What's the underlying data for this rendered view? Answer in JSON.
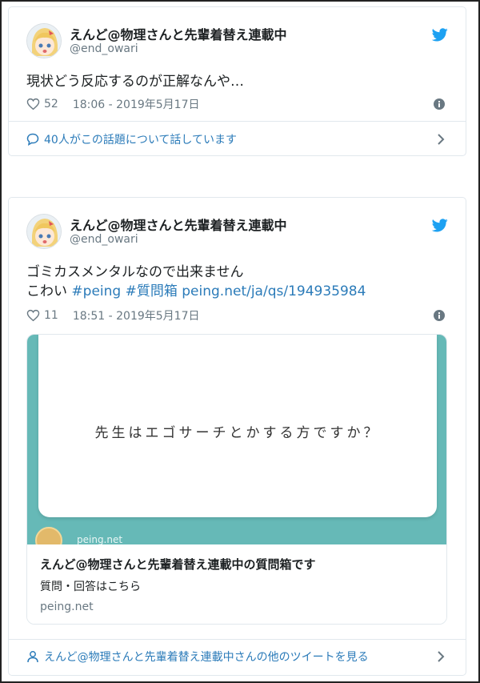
{
  "colors": {
    "twitter_blue": "#1da1f2",
    "link_blue": "#2b7bb9",
    "muted_gray": "#697882",
    "border": "#e1e8ed",
    "card_teal": "#66b9b7"
  },
  "tweets": [
    {
      "author_name": "えんど@物理さんと先輩着替え連載中",
      "author_handle": "@end_owari",
      "text_line1": "現状どう反応するのが正解なんや…",
      "likes": "52",
      "timestamp": "18:06 - 2019年5月17日",
      "footer_link": "40人がこの話題について話しています",
      "icons": {
        "like": "heart-icon",
        "info": "info-icon",
        "reply": "speech-bubble-icon",
        "more": "chevron-right-icon",
        "brand": "twitter-bird-icon"
      }
    },
    {
      "author_name": "えんど@物理さんと先輩着替え連載中",
      "author_handle": "@end_owari",
      "text_line1": "ゴミカスメンタルなので出来ません",
      "text_line2_plain": "こわい",
      "hashtag1": "#peing",
      "hashtag2": "#質問箱",
      "url": "peing.net/ja/qs/194935984",
      "likes": "11",
      "timestamp": "18:51 - 2019年5月17日",
      "card": {
        "question": "先生はエゴサーチとかする方ですか？",
        "site_overlay": "peing.net",
        "title": "えんど@物理さんと先輩着替え連載中の質問箱です",
        "description": "質問・回答はこちら",
        "domain": "peing.net"
      },
      "footer_link": "えんど@物理さんと先輩着替え連載中さんの他のツイートを見る",
      "icons": {
        "like": "heart-icon",
        "info": "info-icon",
        "profile": "person-icon",
        "more": "chevron-right-icon",
        "brand": "twitter-bird-icon"
      }
    }
  ]
}
